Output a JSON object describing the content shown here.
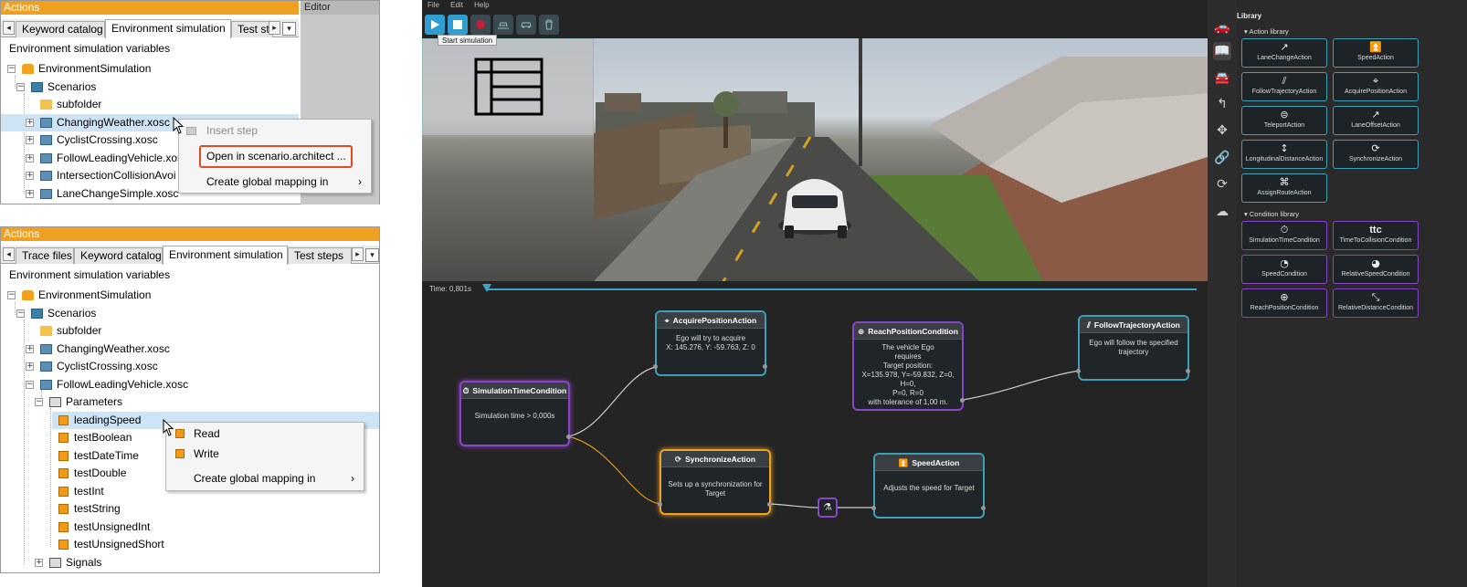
{
  "top_panel": {
    "header": "Actions",
    "editor_header": "Editor",
    "tabs": [
      "Keyword catalog",
      "Environment simulation",
      "Test ste"
    ],
    "subtitle": "Environment simulation variables",
    "tree": {
      "root": "EnvironmentSimulation",
      "scenarios": "Scenarios",
      "items": [
        "subfolder",
        "ChangingWeather.xosc",
        "CyclistCrossing.xosc",
        "FollowLeadingVehicle.xosc",
        "IntersectionCollisionAvoi",
        "LaneChangeSimple.xosc"
      ]
    },
    "context_menu": {
      "items": [
        "Insert step",
        "Open in scenario.architect ...",
        "Create global mapping in"
      ],
      "submenu_arrow": "›"
    }
  },
  "bottom_panel": {
    "header": "Actions",
    "tabs": [
      "Trace files",
      "Keyword catalog",
      "Environment simulation",
      "Test steps"
    ],
    "subtitle": "Environment simulation variables",
    "tree": {
      "root": "EnvironmentSimulation",
      "scenarios": "Scenarios",
      "items": [
        "subfolder",
        "ChangingWeather.xosc",
        "CyclistCrossing.xosc",
        "FollowLeadingVehicle.xosc"
      ],
      "parameters": "Parameters",
      "params": [
        "leadingSpeed",
        "testBoolean",
        "testDateTime",
        "testDouble",
        "testInt",
        "testString",
        "testUnsignedInt",
        "testUnsignedShort"
      ],
      "signals": "Signals"
    },
    "context_menu": {
      "items": [
        "Read",
        "Write",
        "Create global mapping in"
      ],
      "submenu_arrow": "›"
    }
  },
  "sim": {
    "menu": [
      "File",
      "Edit",
      "Help"
    ],
    "tooltip": "Start simulation",
    "time_label": "Time: 0,801s",
    "timeline_progress": 0.0,
    "nodes": {
      "acquire": {
        "title": "AcquirePositionAction",
        "body": "Ego will try to acquire\nX: 145.276, Y: -59.763, Z: 0"
      },
      "reach": {
        "title": "ReachPositionCondition",
        "body": "The vehicle Ego\nrequires\nTarget position:\nX=135.978, Y=-59.832, Z=0, H=0,\nP=0, R=0\nwith tolerance of 1,00 m."
      },
      "follow": {
        "title": "FollowTrajectoryAction",
        "body": "Ego will follow the specified\ntrajectory"
      },
      "simtime": {
        "title": "SimulationTimeCondition",
        "body": "Simulation time > 0,000s"
      },
      "sync": {
        "title": "SynchronizeAction",
        "body": "Sets up a synchronization for Target"
      },
      "speed": {
        "title": "SpeedAction",
        "body": "Adjusts the speed for Target"
      }
    }
  },
  "library": {
    "title": "Library",
    "action_section": "Action library",
    "actions": [
      "LaneChangeAction",
      "SpeedAction",
      "FollowTrajectoryAction",
      "AcquirePositionAction",
      "TeleportAction",
      "LaneOffsetAction",
      "LongitudinalDistanceAction",
      "SynchronizeAction",
      "AssignRouteAction"
    ],
    "condition_section": "Condition library",
    "conditions": [
      "SimulationTimeCondition",
      "TimeToCollisionCondition",
      "SpeedCondition",
      "RelativeSpeedCondition",
      "ReachPositionCondition",
      "RelativeDistanceCondition"
    ],
    "ttc_icon_text": "ttc"
  },
  "colors": {
    "accent_orange": "#f0a020",
    "action_teal": "#3ca0b8",
    "condition_purple": "#8a44c6",
    "highlight_red": "#e34a26"
  }
}
